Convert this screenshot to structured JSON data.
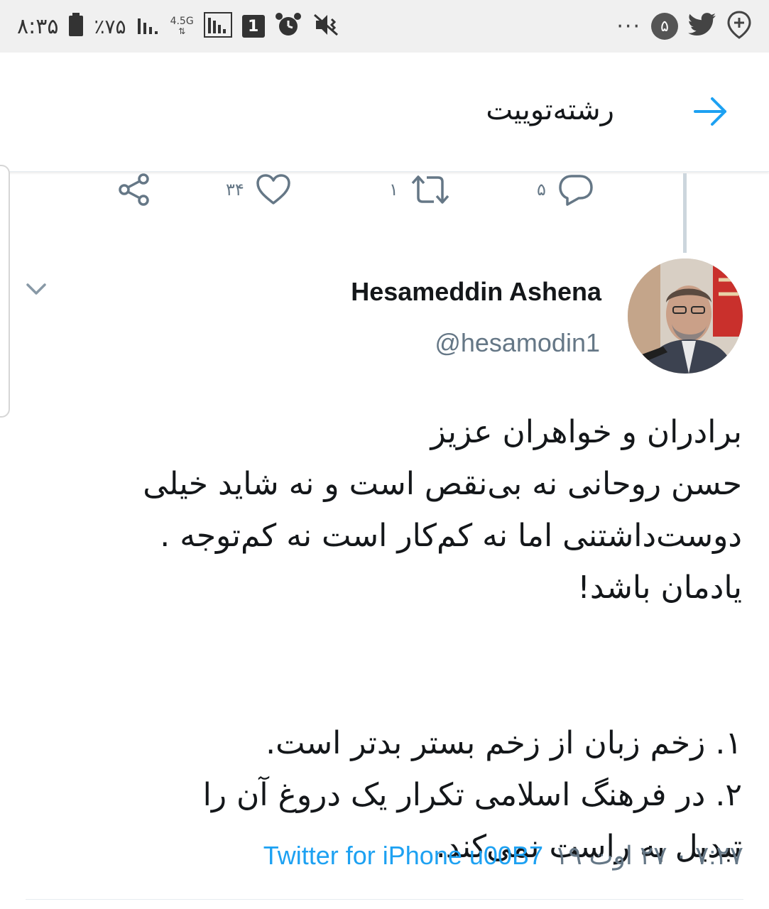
{
  "status_bar": {
    "time": "۸:۳۵",
    "battery_percent": "٪۷۵",
    "network": "4.5G",
    "sim_slot": "1",
    "notification_count": "۵",
    "icons": [
      "battery-icon",
      "signal-icon",
      "network-icon",
      "signal-bars-icon",
      "sim-icon",
      "alarm-icon",
      "vibrate-mute-icon",
      "more-dots-icon",
      "notification-badge-icon",
      "twitter-bird-icon",
      "maps-pin-icon"
    ]
  },
  "header": {
    "title": "رشته‌توییت",
    "back_icon": "arrow-right-icon"
  },
  "previous_tweet_actions": {
    "reply_count": "۵",
    "retweet_count": "۱",
    "like_count": "۳۴"
  },
  "tweet": {
    "author_name": "Hesameddin Ashena",
    "author_handle": "@hesamodin1",
    "text_lines": [
      "برادران و خواهران عزیز",
      "حسن روحانی نه بی‌نقص است و نه شاید خیلی",
      "دوست‌داشتنی اما نه کم‌کار است نه کم‌توجه .",
      "یادمان باشد!",
      "۱. زخم زبان از زخم بستر بدتر است.",
      "۲. در فرهنگ اسلامی تکرار یک دروغ آن را",
      "تبدیل به راست نمی‌کند."
    ],
    "timestamp": "۷:۲۷ ۰ ۲۷ اوت ۱۹",
    "separator": "u00B7",
    "source": "Twitter for iPhone"
  },
  "colors": {
    "accent": "#1da1f2",
    "secondary_text": "#657786",
    "primary_text": "#14171a",
    "status_bar_bg": "#f0f0f0"
  }
}
